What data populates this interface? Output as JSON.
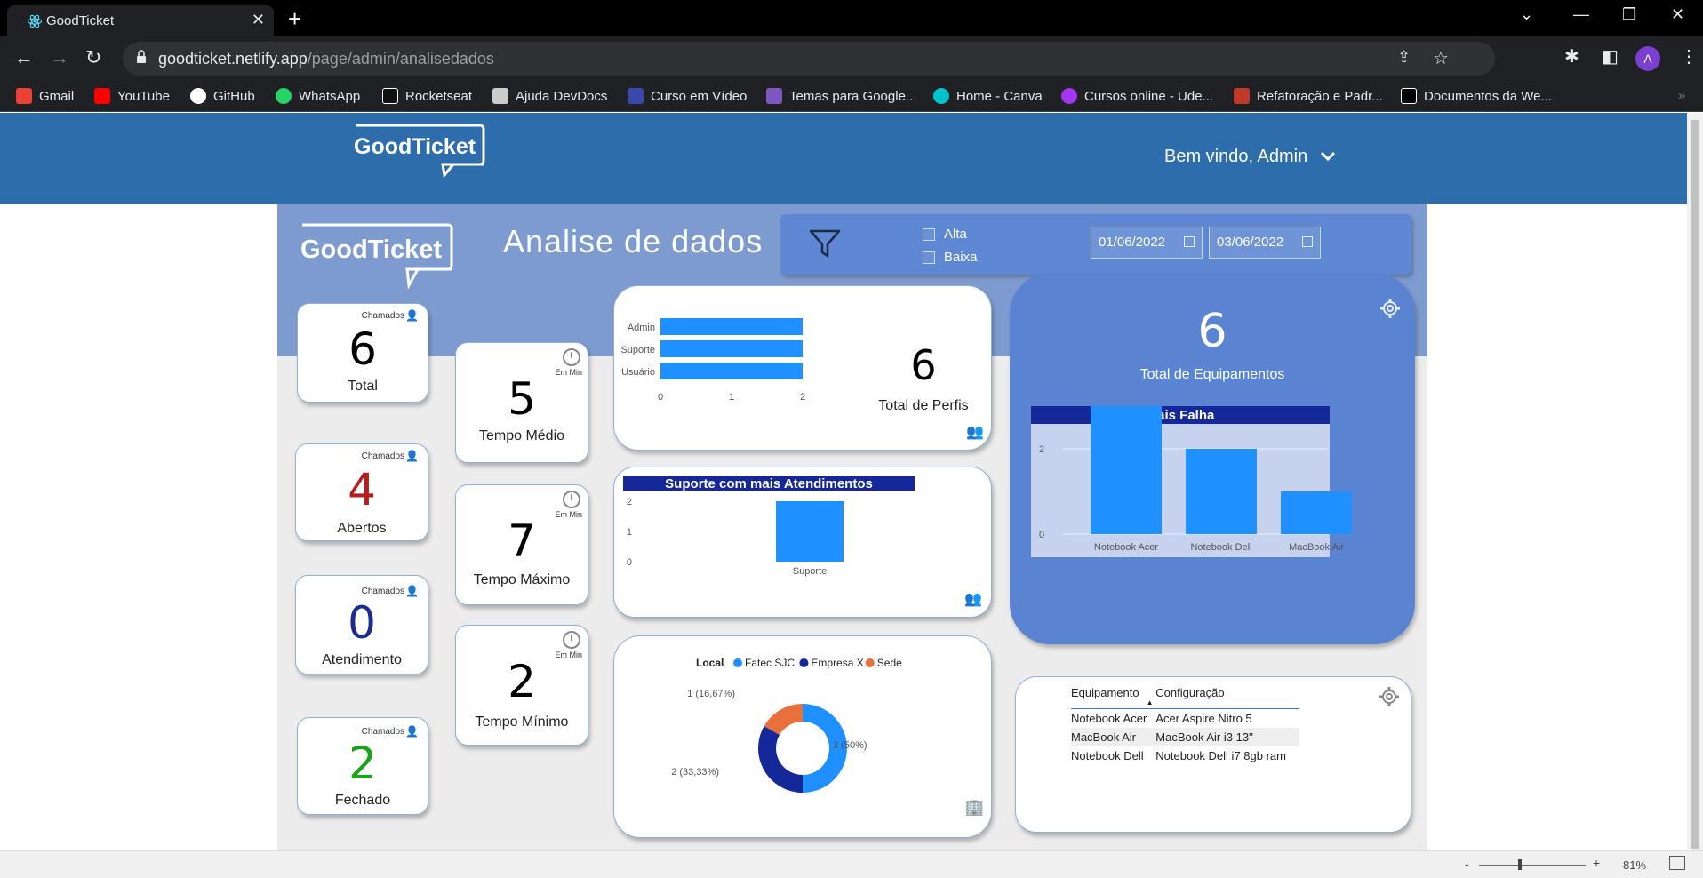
{
  "browser": {
    "tab_title": "GoodTicket",
    "url_host": "goodticket.netlify.app",
    "url_path": "/page/admin/analisedados",
    "avatar_letter": "A",
    "bookmarks": [
      "Gmail",
      "YouTube",
      "GitHub",
      "WhatsApp",
      "Rocketseat",
      "Ajuda DevDocs",
      "Curso em Vídeo",
      "Temas para Google...",
      "Home - Canva",
      "Cursos online - Ude...",
      "Refatoração e Padr...",
      "Documentos da We..."
    ],
    "bookmark_colors": [
      "#ea4335",
      "#ff0000",
      "#ffffff",
      "#25d366",
      "#ffffff",
      "#cccccc",
      "#3949ab",
      "#7e57c2",
      "#00c4cc",
      "#a435f0",
      "#c0392b",
      "#ffffff"
    ],
    "zoom": "81%"
  },
  "app": {
    "logo": "GoodTicket",
    "welcome": "Bem vindo, Admin"
  },
  "report": {
    "logo": "GoodTicket",
    "title": "Analise de dados",
    "filters": {
      "priority": [
        "Alta",
        "Baixa"
      ],
      "date_from": "01/06/2022",
      "date_to": "03/06/2022"
    },
    "tickets": {
      "tag": "Chamados",
      "items": [
        {
          "value": "6",
          "label": "Total",
          "color": "#000000"
        },
        {
          "value": "4",
          "label": "Abertos",
          "color": "#b71c1c"
        },
        {
          "value": "0",
          "label": "Atendimento",
          "color": "#1a2d8f"
        },
        {
          "value": "2",
          "label": "Fechado",
          "color": "#1aa31a"
        }
      ]
    },
    "times": {
      "tag": "Em Min",
      "items": [
        {
          "value": "5",
          "label": "Tempo Médio"
        },
        {
          "value": "7",
          "label": "Tempo Máximo"
        },
        {
          "value": "2",
          "label": "Tempo Mínimo"
        }
      ]
    },
    "profiles": {
      "value": "6",
      "label": "Total de Perfis"
    },
    "equipment": {
      "value": "6",
      "label": "Total de Equipamentos"
    },
    "equipment_table": {
      "headers": [
        "Equipamento",
        "Configuração"
      ],
      "rows": [
        [
          "Notebook Acer",
          "Acer Aspire Nitro 5"
        ],
        [
          "MacBook Air",
          "MacBook Air i3 13''"
        ],
        [
          "Notebook Dell",
          "Notebook Dell i7 8gb ram"
        ]
      ]
    }
  },
  "chart_data": [
    {
      "type": "bar",
      "orientation": "horizontal",
      "categories": [
        "Admin",
        "Suporte",
        "Usuário"
      ],
      "values": [
        2,
        2,
        2
      ],
      "xlim": [
        0,
        2
      ],
      "xticks": [
        0,
        1,
        2
      ],
      "color": "#1e90ff"
    },
    {
      "type": "bar",
      "title": "Suporte com mais Atendimentos",
      "categories": [
        "Suporte"
      ],
      "values": [
        2
      ],
      "ylim": [
        0,
        2
      ],
      "yticks": [
        0,
        1,
        2
      ],
      "color": "#1e90ff"
    },
    {
      "type": "pie",
      "style": "donut",
      "legend_title": "Local",
      "labels": [
        "Fatec SJC",
        "Empresa X",
        "Sede"
      ],
      "values": [
        3,
        2,
        1
      ],
      "data_labels": [
        "3 (50%)",
        "2 (33,33%)",
        "1 (16,67%)"
      ],
      "colors": [
        "#1e90ff",
        "#14289a",
        "#e8703a"
      ]
    },
    {
      "type": "bar",
      "title": "Mais Falha",
      "categories": [
        "Notebook Acer",
        "Notebook Dell",
        "MacBook Air"
      ],
      "values": [
        3,
        2,
        1
      ],
      "yticks": [
        0,
        2
      ],
      "color": "#1e90ff"
    }
  ]
}
